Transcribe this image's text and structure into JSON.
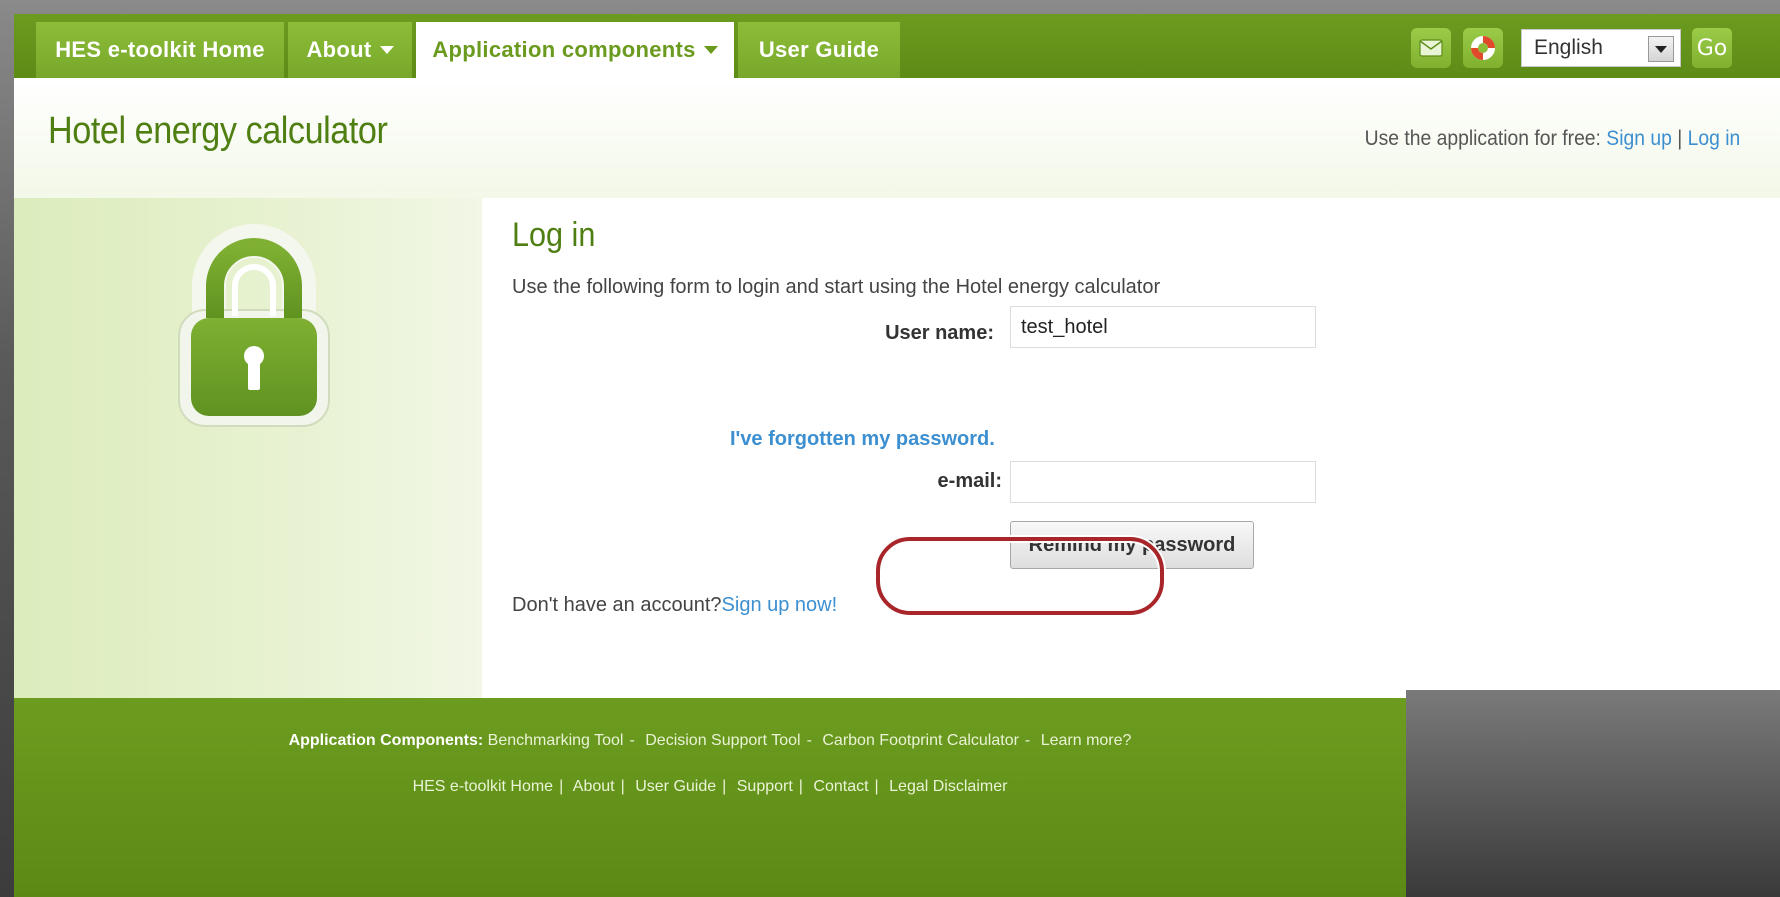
{
  "nav": {
    "items": [
      {
        "label": "HES e-toolkit Home",
        "has_caret": false,
        "active": false
      },
      {
        "label": "About",
        "has_caret": true,
        "active": false
      },
      {
        "label": "Application components",
        "has_caret": true,
        "active": true
      },
      {
        "label": "User Guide",
        "has_caret": false,
        "active": false
      }
    ],
    "icons": [
      "mail-icon",
      "help-lifebuoy-icon"
    ],
    "language_selected": "English",
    "go_label": "Go"
  },
  "header": {
    "title": "Hotel energy calculator",
    "signup_prefix": "Use the application for free: ",
    "signup_link": "Sign up",
    "separator": " | ",
    "login_link": "Log in"
  },
  "login": {
    "title": "Log in",
    "description": "Use the following form to login and start using the Hotel energy calculator",
    "username_label": "User name:",
    "username_value": "test_hotel",
    "forgot_link": "I've forgotten my password.",
    "email_label": "e-mail:",
    "email_value": "",
    "remind_button": "Remind my password",
    "no_account_text": "Don't have an account?",
    "signup_now_link": "Sign up now!"
  },
  "footer": {
    "components_label": "Application Components:",
    "components": [
      "Benchmarking Tool",
      "Decision Support Tool",
      "Carbon Footprint Calculator",
      "Learn more?"
    ],
    "links": [
      "HES e-toolkit Home",
      "About",
      "User Guide",
      "Support",
      "Contact",
      "Legal Disclaimer"
    ]
  },
  "colors": {
    "brand_green": "#5c8c16",
    "nav_tab_green": "#8cbc38",
    "title_green": "#4f7f12",
    "link_blue": "#3c8fd0",
    "highlight_red": "#a8262a"
  }
}
